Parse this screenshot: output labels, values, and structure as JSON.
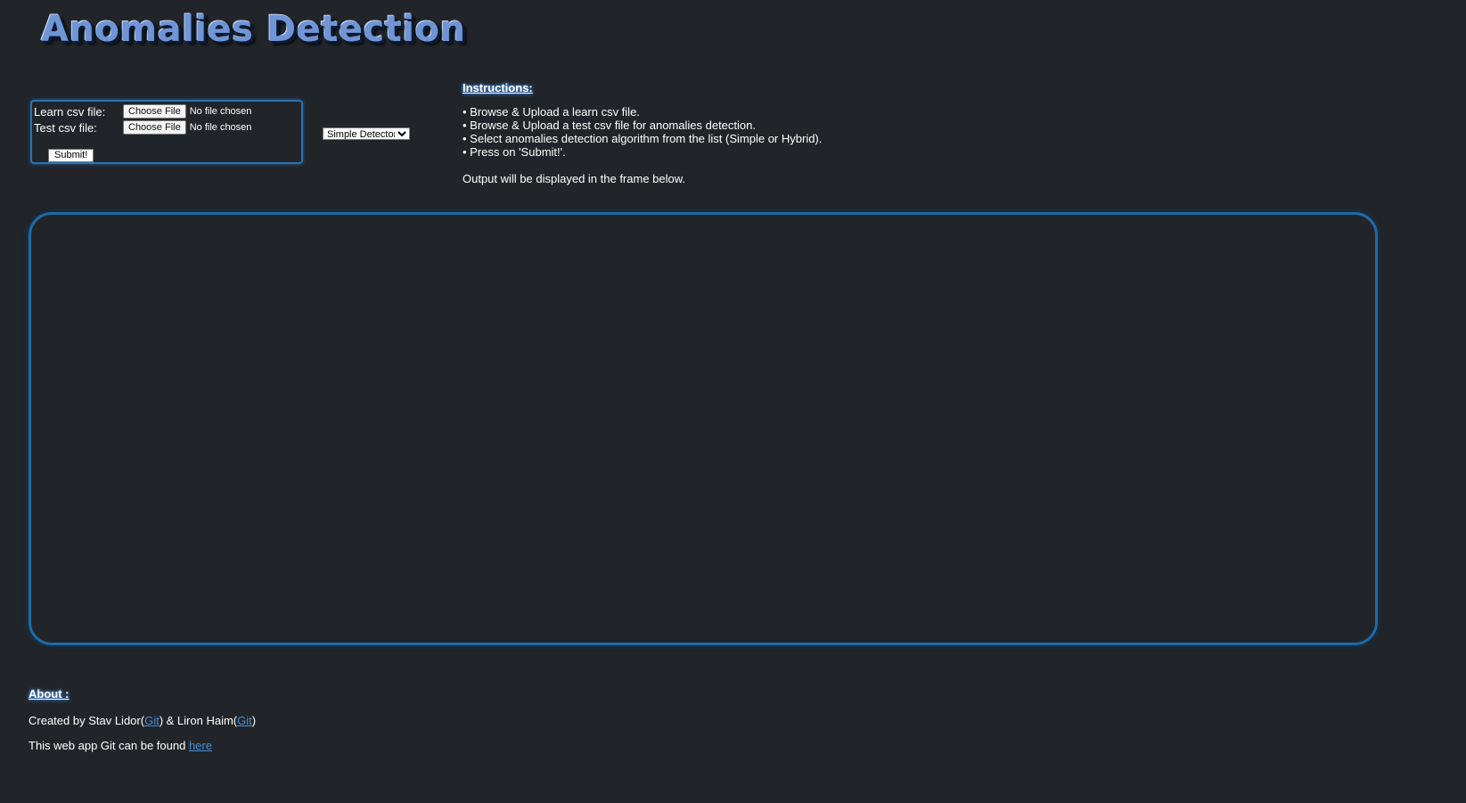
{
  "app": {
    "title": "Anomalies Detection"
  },
  "upload_form": {
    "learn_label": "Learn csv file:",
    "test_label": "Test csv file:",
    "choose_file_label": "Choose File",
    "no_file_text": "No file chosen",
    "submit_label": "Submit!"
  },
  "algorithm_select": {
    "selected": "Simple Detector"
  },
  "instructions": {
    "heading": "Instructions:",
    "steps": [
      "• Browse & Upload a learn csv file.",
      "• Browse & Upload a test csv file for anomalies detection.",
      "• Select anomalies detection algorithm from the list (Simple or Hybrid).",
      "• Press on 'Submit!'."
    ],
    "output_note": "Output will be displayed in the frame below."
  },
  "about": {
    "heading": "About :",
    "created_prefix": "Created by Stav Lidor(",
    "git_link_1": "Git",
    "created_middle": ") & Liron Haim(",
    "git_link_2": "Git",
    "created_suffix": ")",
    "repo_prefix": "This web app Git can be found ",
    "repo_link": "here"
  },
  "colors": {
    "background": "#212529",
    "accent_border": "#1e6aa8",
    "title_color": "#6f95d6",
    "link_color": "#4a8fd4"
  }
}
